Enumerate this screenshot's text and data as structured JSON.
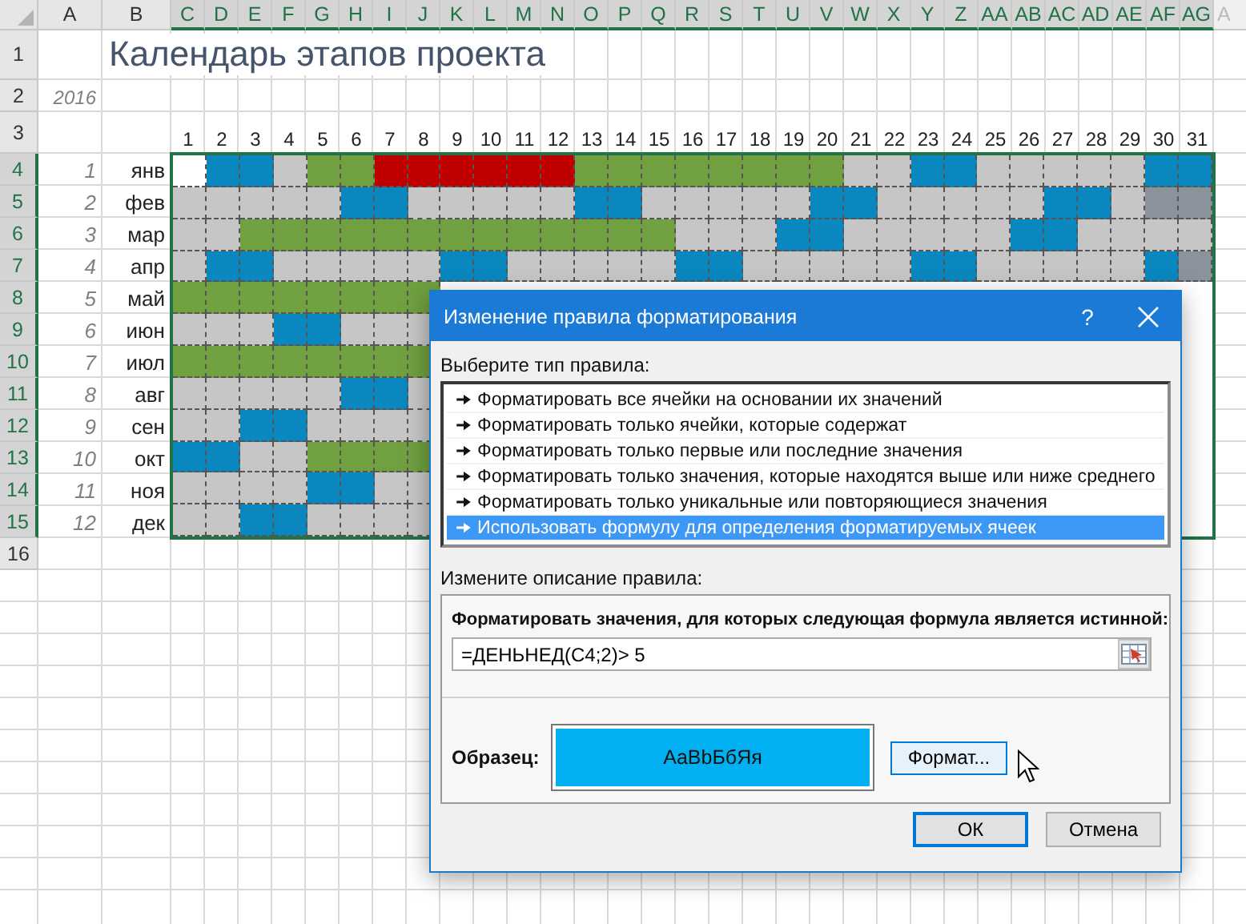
{
  "spreadsheet": {
    "column_headers": [
      {
        "label": "A",
        "selected": false
      },
      {
        "label": "B",
        "selected": false
      },
      {
        "label": "C",
        "selected": true
      },
      {
        "label": "D",
        "selected": true
      },
      {
        "label": "E",
        "selected": true
      },
      {
        "label": "F",
        "selected": true
      },
      {
        "label": "G",
        "selected": true
      },
      {
        "label": "H",
        "selected": true
      },
      {
        "label": "I",
        "selected": true
      },
      {
        "label": "J",
        "selected": true
      },
      {
        "label": "K",
        "selected": true
      },
      {
        "label": "L",
        "selected": true
      },
      {
        "label": "M",
        "selected": true
      },
      {
        "label": "N",
        "selected": true
      },
      {
        "label": "O",
        "selected": true
      },
      {
        "label": "P",
        "selected": true
      },
      {
        "label": "Q",
        "selected": true
      },
      {
        "label": "R",
        "selected": true
      },
      {
        "label": "S",
        "selected": true
      },
      {
        "label": "T",
        "selected": true
      },
      {
        "label": "U",
        "selected": true
      },
      {
        "label": "V",
        "selected": true
      },
      {
        "label": "W",
        "selected": true
      },
      {
        "label": "X",
        "selected": true
      },
      {
        "label": "Y",
        "selected": true
      },
      {
        "label": "Z",
        "selected": true
      },
      {
        "label": "AA",
        "selected": true
      },
      {
        "label": "AB",
        "selected": true
      },
      {
        "label": "AC",
        "selected": true
      },
      {
        "label": "AD",
        "selected": true
      },
      {
        "label": "AE",
        "selected": true
      },
      {
        "label": "AF",
        "selected": true
      },
      {
        "label": "AG",
        "selected": true
      },
      {
        "label": "A",
        "selected": false
      }
    ],
    "title_row": {
      "row": "1",
      "title": "Календарь этапов проекта"
    },
    "year_row": {
      "row": "2",
      "year": "2016"
    },
    "days_row": {
      "row": "3",
      "days": [
        "1",
        "2",
        "3",
        "4",
        "5",
        "6",
        "7",
        "8",
        "9",
        "10",
        "11",
        "12",
        "13",
        "14",
        "15",
        "16",
        "17",
        "18",
        "19",
        "20",
        "21",
        "22",
        "23",
        "24",
        "25",
        "26",
        "27",
        "28",
        "29",
        "30",
        "31"
      ]
    },
    "months": [
      {
        "row": "4",
        "selected": true,
        "index": "1",
        "name": "янв",
        "cells": [
          {
            "color": "#ffffff"
          },
          {
            "color": "#0a87bf"
          },
          {
            "color": "#0a87bf"
          },
          {
            "color": "#c6c6c6"
          },
          {
            "color": "#70a040"
          },
          {
            "color": "#70a040"
          },
          {
            "color": "#c00000"
          },
          {
            "color": "#c00000"
          },
          {
            "color": "#c00000"
          },
          {
            "color": "#c00000"
          },
          {
            "color": "#c00000"
          },
          {
            "color": "#c00000"
          },
          {
            "color": "#70a040"
          },
          {
            "color": "#70a040"
          },
          {
            "color": "#70a040"
          },
          {
            "color": "#70a040"
          },
          {
            "color": "#70a040"
          },
          {
            "color": "#70a040"
          },
          {
            "color": "#70a040"
          },
          {
            "color": "#70a040"
          },
          {
            "color": "#c6c6c6"
          },
          {
            "color": "#c6c6c6"
          },
          {
            "color": "#0a87bf"
          },
          {
            "color": "#0a87bf"
          },
          {
            "color": "#c6c6c6"
          },
          {
            "color": "#c6c6c6"
          },
          {
            "color": "#c6c6c6"
          },
          {
            "color": "#c6c6c6"
          },
          {
            "color": "#c6c6c6"
          },
          {
            "color": "#0a87bf"
          },
          {
            "color": "#0a87bf"
          }
        ]
      },
      {
        "row": "5",
        "selected": true,
        "index": "2",
        "name": "фев",
        "cells": [
          {
            "color": "#c6c6c6"
          },
          {
            "color": "#c6c6c6"
          },
          {
            "color": "#c6c6c6"
          },
          {
            "color": "#c6c6c6"
          },
          {
            "color": "#c6c6c6"
          },
          {
            "color": "#0a87bf"
          },
          {
            "color": "#0a87bf"
          },
          {
            "color": "#c6c6c6"
          },
          {
            "color": "#c6c6c6"
          },
          {
            "color": "#c6c6c6"
          },
          {
            "color": "#c6c6c6"
          },
          {
            "color": "#c6c6c6"
          },
          {
            "color": "#0a87bf"
          },
          {
            "color": "#0a87bf"
          },
          {
            "color": "#c6c6c6"
          },
          {
            "color": "#c6c6c6"
          },
          {
            "color": "#c6c6c6"
          },
          {
            "color": "#c6c6c6"
          },
          {
            "color": "#c6c6c6"
          },
          {
            "color": "#0a87bf"
          },
          {
            "color": "#0a87bf"
          },
          {
            "color": "#c6c6c6"
          },
          {
            "color": "#c6c6c6"
          },
          {
            "color": "#c6c6c6"
          },
          {
            "color": "#c6c6c6"
          },
          {
            "color": "#c6c6c6"
          },
          {
            "color": "#0a87bf"
          },
          {
            "color": "#0a87bf"
          },
          {
            "color": "#c6c6c6"
          },
          {
            "color": "#8a929c"
          },
          {
            "color": "#8a929c"
          }
        ]
      },
      {
        "row": "6",
        "selected": true,
        "index": "3",
        "name": "мар",
        "cells": [
          {
            "color": "#c6c6c6"
          },
          {
            "color": "#c6c6c6"
          },
          {
            "color": "#70a040"
          },
          {
            "color": "#70a040"
          },
          {
            "color": "#70a040"
          },
          {
            "color": "#70a040"
          },
          {
            "color": "#70a040"
          },
          {
            "color": "#70a040"
          },
          {
            "color": "#70a040"
          },
          {
            "color": "#70a040"
          },
          {
            "color": "#70a040"
          },
          {
            "color": "#70a040"
          },
          {
            "color": "#70a040"
          },
          {
            "color": "#70a040"
          },
          {
            "color": "#70a040"
          },
          {
            "color": "#c6c6c6"
          },
          {
            "color": "#c6c6c6"
          },
          {
            "color": "#c6c6c6"
          },
          {
            "color": "#0a87bf"
          },
          {
            "color": "#0a87bf"
          },
          {
            "color": "#c6c6c6"
          },
          {
            "color": "#c6c6c6"
          },
          {
            "color": "#c6c6c6"
          },
          {
            "color": "#c6c6c6"
          },
          {
            "color": "#c6c6c6"
          },
          {
            "color": "#0a87bf"
          },
          {
            "color": "#0a87bf"
          },
          {
            "color": "#c6c6c6"
          },
          {
            "color": "#c6c6c6"
          },
          {
            "color": "#c6c6c6"
          },
          {
            "color": "#c6c6c6"
          }
        ]
      },
      {
        "row": "7",
        "selected": true,
        "index": "4",
        "name": "апр",
        "cells": [
          {
            "color": "#c6c6c6"
          },
          {
            "color": "#0a87bf"
          },
          {
            "color": "#0a87bf"
          },
          {
            "color": "#c6c6c6"
          },
          {
            "color": "#c6c6c6"
          },
          {
            "color": "#c6c6c6"
          },
          {
            "color": "#c6c6c6"
          },
          {
            "color": "#c6c6c6"
          },
          {
            "color": "#0a87bf"
          },
          {
            "color": "#0a87bf"
          },
          {
            "color": "#c6c6c6"
          },
          {
            "color": "#c6c6c6"
          },
          {
            "color": "#c6c6c6"
          },
          {
            "color": "#c6c6c6"
          },
          {
            "color": "#c6c6c6"
          },
          {
            "color": "#0a87bf"
          },
          {
            "color": "#0a87bf"
          },
          {
            "color": "#c6c6c6"
          },
          {
            "color": "#c6c6c6"
          },
          {
            "color": "#c6c6c6"
          },
          {
            "color": "#c6c6c6"
          },
          {
            "color": "#c6c6c6"
          },
          {
            "color": "#0a87bf"
          },
          {
            "color": "#0a87bf"
          },
          {
            "color": "#c6c6c6"
          },
          {
            "color": "#c6c6c6"
          },
          {
            "color": "#c6c6c6"
          },
          {
            "color": "#c6c6c6"
          },
          {
            "color": "#c6c6c6"
          },
          {
            "color": "#0a87bf"
          },
          {
            "color": "#8a929c"
          }
        ]
      },
      {
        "row": "8",
        "selected": true,
        "index": "5",
        "name": "май",
        "cells": [
          {
            "color": "#70a040"
          },
          {
            "color": "#70a040"
          },
          {
            "color": "#70a040"
          },
          {
            "color": "#70a040"
          },
          {
            "color": "#70a040"
          },
          {
            "color": "#70a040"
          },
          {
            "color": "#70a040"
          },
          {
            "color": "#70a040"
          }
        ]
      },
      {
        "row": "9",
        "selected": true,
        "index": "6",
        "name": "июн",
        "cells": [
          {
            "color": "#c6c6c6"
          },
          {
            "color": "#c6c6c6"
          },
          {
            "color": "#c6c6c6"
          },
          {
            "color": "#0a87bf"
          },
          {
            "color": "#0a87bf"
          },
          {
            "color": "#c6c6c6"
          },
          {
            "color": "#c6c6c6"
          },
          {
            "color": "#c6c6c6"
          }
        ]
      },
      {
        "row": "10",
        "selected": true,
        "index": "7",
        "name": "июл",
        "cells": [
          {
            "color": "#70a040"
          },
          {
            "color": "#70a040"
          },
          {
            "color": "#70a040"
          },
          {
            "color": "#70a040"
          },
          {
            "color": "#70a040"
          },
          {
            "color": "#70a040"
          },
          {
            "color": "#70a040"
          },
          {
            "color": "#70a040"
          }
        ]
      },
      {
        "row": "11",
        "selected": true,
        "index": "8",
        "name": "авг",
        "cells": [
          {
            "color": "#c6c6c6"
          },
          {
            "color": "#c6c6c6"
          },
          {
            "color": "#c6c6c6"
          },
          {
            "color": "#c6c6c6"
          },
          {
            "color": "#c6c6c6"
          },
          {
            "color": "#0a87bf"
          },
          {
            "color": "#0a87bf"
          },
          {
            "color": "#c6c6c6"
          }
        ]
      },
      {
        "row": "12",
        "selected": true,
        "index": "9",
        "name": "сен",
        "cells": [
          {
            "color": "#c6c6c6"
          },
          {
            "color": "#c6c6c6"
          },
          {
            "color": "#0a87bf"
          },
          {
            "color": "#0a87bf"
          },
          {
            "color": "#c6c6c6"
          },
          {
            "color": "#c6c6c6"
          },
          {
            "color": "#c6c6c6"
          },
          {
            "color": "#c6c6c6"
          }
        ]
      },
      {
        "row": "13",
        "selected": true,
        "index": "10",
        "name": "окт",
        "cells": [
          {
            "color": "#0a87bf"
          },
          {
            "color": "#0a87bf"
          },
          {
            "color": "#c6c6c6"
          },
          {
            "color": "#c6c6c6"
          },
          {
            "color": "#70a040"
          },
          {
            "color": "#70a040"
          },
          {
            "color": "#70a040"
          },
          {
            "color": "#70a040"
          }
        ]
      },
      {
        "row": "14",
        "selected": true,
        "index": "11",
        "name": "ноя",
        "cells": [
          {
            "color": "#c6c6c6"
          },
          {
            "color": "#c6c6c6"
          },
          {
            "color": "#c6c6c6"
          },
          {
            "color": "#c6c6c6"
          },
          {
            "color": "#0a87bf"
          },
          {
            "color": "#0a87bf"
          },
          {
            "color": "#c6c6c6"
          },
          {
            "color": "#c6c6c6"
          }
        ]
      },
      {
        "row": "15",
        "selected": true,
        "index": "12",
        "name": "дек",
        "cells": [
          {
            "color": "#c6c6c6"
          },
          {
            "color": "#c6c6c6"
          },
          {
            "color": "#0a87bf"
          },
          {
            "color": "#0a87bf"
          },
          {
            "color": "#c6c6c6"
          },
          {
            "color": "#c6c6c6"
          },
          {
            "color": "#c6c6c6"
          },
          {
            "color": "#c6c6c6"
          }
        ]
      }
    ],
    "empty_rows": [
      "16"
    ]
  },
  "dialog": {
    "title": "Изменение правила форматирования",
    "help_button": "?",
    "rule_type_label": "Выберите тип правила:",
    "rule_types": [
      {
        "text": "Форматировать все ячейки на основании их значений",
        "selected": false
      },
      {
        "text": "Форматировать только ячейки, которые содержат",
        "selected": false
      },
      {
        "text": "Форматировать только первые или последние значения",
        "selected": false
      },
      {
        "text": "Форматировать только значения, которые находятся выше или ниже среднего",
        "selected": false
      },
      {
        "text": "Форматировать только уникальные или повторяющиеся значения",
        "selected": false
      },
      {
        "text": "Использовать формулу для определения форматируемых ячеек",
        "selected": true
      }
    ],
    "description_label": "Измените описание правила:",
    "formula_label": "Форматировать значения, для которых следующая формула является истинной:",
    "formula": "=ДЕНЬНЕД(C4;2)> 5",
    "preview_label": "Образец:",
    "preview_text": "AaBbБбЯя",
    "format_button": {
      "label": "Формат...",
      "hovered": true
    },
    "buttons": [
      {
        "label": "ОК",
        "default": true
      },
      {
        "label": "Отмена",
        "default": false
      }
    ]
  }
}
